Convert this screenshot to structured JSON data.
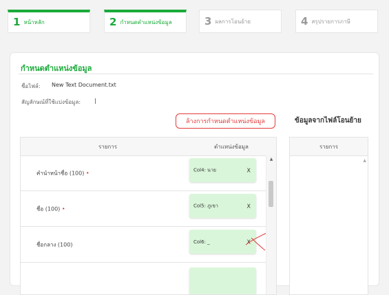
{
  "steps": [
    {
      "num": "1",
      "label": "หน้าหลัก"
    },
    {
      "num": "2",
      "label": "กำหนดตำแหน่งข้อมูล"
    },
    {
      "num": "3",
      "label": "ผลการโอนย้าย"
    },
    {
      "num": "4",
      "label": "สรุปรายการภาษี"
    }
  ],
  "section": {
    "title": "กำหนดตำแหน่งข้อมูล",
    "file_label": "ชื่อไฟล์:",
    "file_name": "New Text Document.txt",
    "separator_label": "สัญลักษณ์ที่ใช้แบ่งข้อมูล:",
    "separator_value": "|"
  },
  "clear_button": "ล้างการกำหนดตำแหน่งข้อมูล",
  "data_from_file_title": "ข้อมูลจากไฟล์โอนย้าย",
  "table": {
    "col_item": "รายการ",
    "col_position": "ตำแหน่งข้อมูล",
    "rows": [
      {
        "name": "คำนำหน้าชื่อ (100)",
        "required_mark": "•",
        "chip": "Col4: นาย",
        "remove": "X"
      },
      {
        "name": "ชื่อ (100)",
        "required_mark": "•",
        "chip": "Col5: ภูเขา",
        "remove": "X"
      },
      {
        "name": "ชื่อกลาง (100)",
        "required_mark": "",
        "chip": "Col6: _",
        "remove": "X"
      },
      {
        "name": "",
        "required_mark": "",
        "chip": "",
        "remove": ""
      }
    ],
    "scroll_up": "▲"
  },
  "right_table": {
    "col_item": "รายการ",
    "scroll_up": "▲"
  },
  "colors": {
    "accent": "#1aaa3a",
    "danger": "#e23a3a",
    "chip_bg": "#daf6da"
  }
}
